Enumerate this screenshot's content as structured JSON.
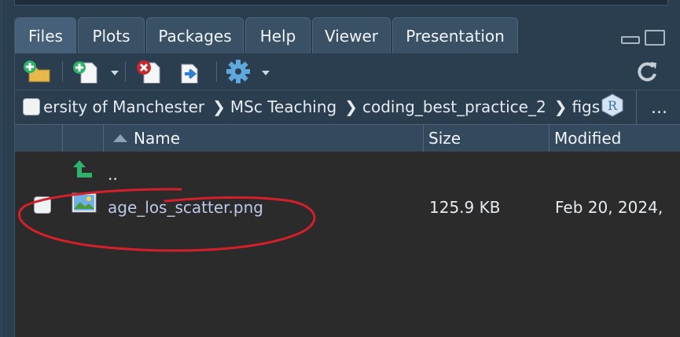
{
  "tabs": [
    {
      "label": "Files",
      "active": true
    },
    {
      "label": "Plots",
      "active": false
    },
    {
      "label": "Packages",
      "active": false
    },
    {
      "label": "Help",
      "active": false
    },
    {
      "label": "Viewer",
      "active": false
    },
    {
      "label": "Presentation",
      "active": false
    }
  ],
  "breadcrumb": {
    "items": [
      "ersity of Manchester",
      "MSc Teaching",
      "coding_best_practice_2",
      "figs"
    ],
    "overflow_label": "..."
  },
  "columns": {
    "name": "Name",
    "size": "Size",
    "modified": "Modified"
  },
  "files": [
    {
      "name": "..",
      "size": "",
      "modified": "",
      "type": "parent-dir"
    },
    {
      "name": "age_los_scatter.png",
      "size": "125.9 KB",
      "modified": "Feb 20, 2024,",
      "type": "image"
    }
  ],
  "colors": {
    "chrome": "#2b3e50",
    "pane_bg": "#2b2b2b",
    "file_link": "#bdc8e8",
    "annotation": "#d4202a",
    "up_arrow": "#2fb36a"
  }
}
